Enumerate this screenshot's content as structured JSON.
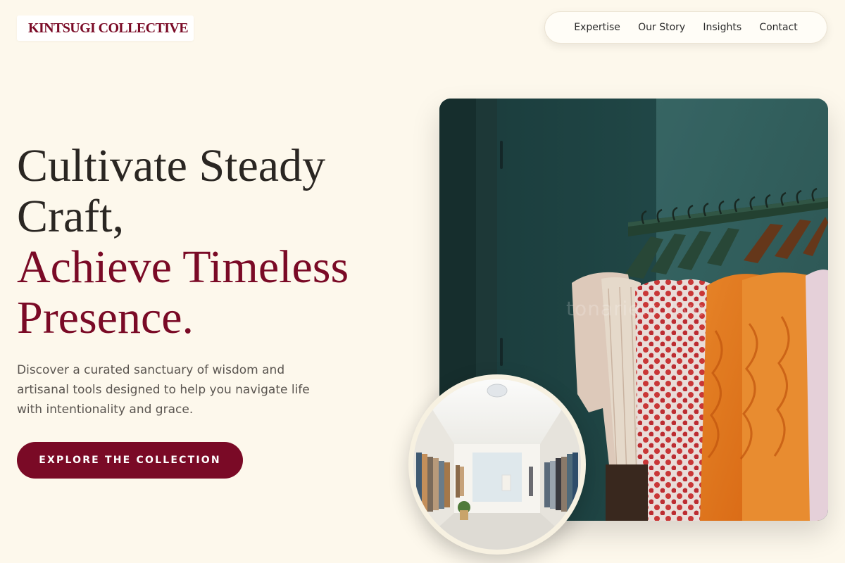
{
  "brand": {
    "name": "KINTSUGI COLLECTIVE",
    "accent_color": "#7a0a26",
    "background_color": "#fdf8ec"
  },
  "nav": {
    "items": [
      {
        "label": "Expertise"
      },
      {
        "label": "Our Story"
      },
      {
        "label": "Insights"
      },
      {
        "label": "Contact"
      }
    ]
  },
  "hero": {
    "headline_line1": "Cultivate Steady",
    "headline_line2": "Craft,",
    "headline_accent_line1": "Achieve Timeless",
    "headline_accent_line2": "Presence.",
    "description": "Discover a curated sanctuary of wisdom and artisanal tools designed to help you navigate life with intentionality and grace.",
    "cta_label": "EXPLORE THE COLLECTION"
  },
  "images": {
    "main_photo": {
      "subject": "clothing rack with orange, floral and cream garments against a teal wall",
      "watermark": "tonarie.tokyo"
    },
    "circle_photo": {
      "subject": "bright boutique interior with clothing racks on both sides"
    }
  }
}
